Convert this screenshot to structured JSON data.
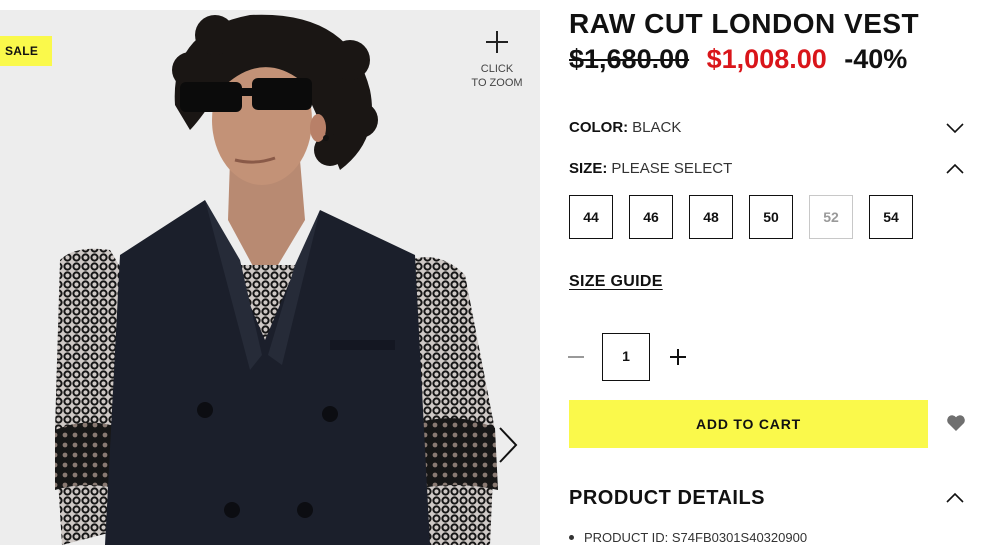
{
  "gallery": {
    "sale_badge": "SALE",
    "zoom_line1": "CLICK",
    "zoom_line2": "TO ZOOM",
    "zoom_icon": "plus-icon",
    "next_icon": "chevron-right-icon"
  },
  "product": {
    "title": "RAW CUT LONDON VEST",
    "original_price": "$1,680.00",
    "sale_price": "$1,008.00",
    "discount": "-40%"
  },
  "options": {
    "color_label": "COLOR:",
    "color_value": "BLACK",
    "size_label": "SIZE:",
    "size_value": "PLEASE SELECT",
    "sizes": [
      {
        "label": "44",
        "available": true
      },
      {
        "label": "46",
        "available": true
      },
      {
        "label": "48",
        "available": true
      },
      {
        "label": "50",
        "available": true
      },
      {
        "label": "52",
        "available": false
      },
      {
        "label": "54",
        "available": true
      }
    ],
    "size_guide": "SIZE GUIDE"
  },
  "cart": {
    "quantity": "1",
    "add_to_cart": "ADD TO CART",
    "wishlist_icon": "heart-icon"
  },
  "details": {
    "heading": "PRODUCT DETAILS",
    "product_id": "PRODUCT ID: S74FB0301S40320900"
  },
  "colors": {
    "accent_yellow": "#faf94b",
    "sale_red": "#d9151a",
    "disabled_gray": "#9a9a9a"
  }
}
